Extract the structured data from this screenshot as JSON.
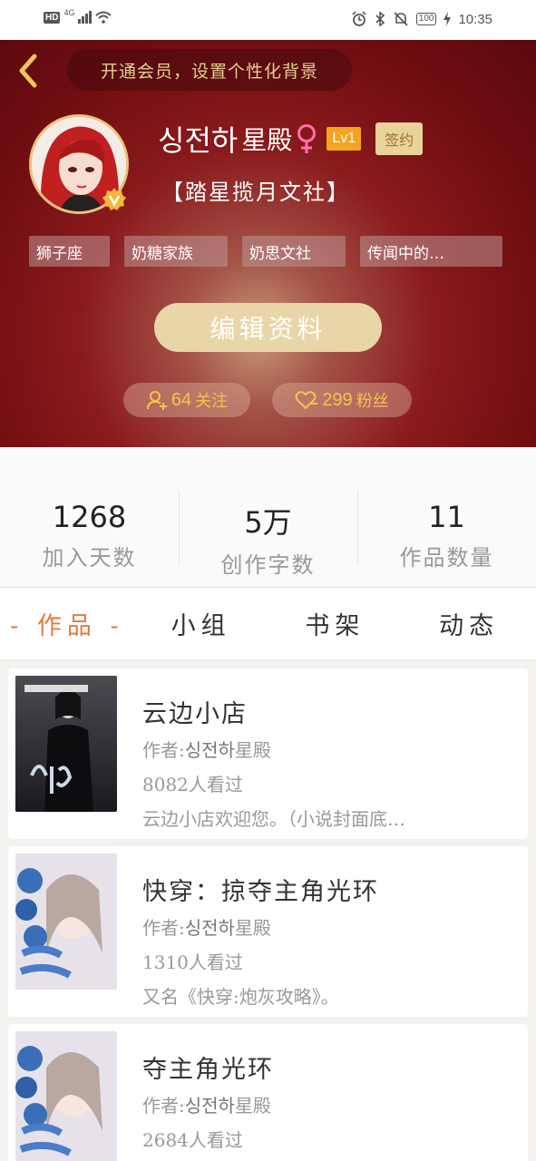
{
  "status_bar": {
    "network_hd": "HD",
    "network_type": "4G",
    "battery": "100",
    "time": "10:35"
  },
  "header": {
    "vip_banner": "开通会员，设置个性化背景",
    "name_main": "싱전하",
    "name_suffix": "星殿",
    "level": "Lv1",
    "sign_badge": "签约",
    "organization": "【踏星揽月文社】",
    "tags": [
      "狮子座",
      "奶糖家族",
      "奶思文社",
      "传闻中的…"
    ],
    "edit_button": "编辑资料",
    "following_count": "64",
    "following_label": "关注",
    "fans_count": "299",
    "fans_label": "粉丝"
  },
  "stats": [
    {
      "value": "1268",
      "label": "加入天数"
    },
    {
      "value": "5万",
      "label": "创作字数"
    },
    {
      "value": "11",
      "label": "作品数量"
    }
  ],
  "tabs": [
    "- 作品 -",
    "小组",
    "书架",
    "动态"
  ],
  "works": [
    {
      "title": "云边小店",
      "author_prefix": "作者:",
      "author_name": "싱전하",
      "author_suffix": "星殿",
      "views": "8082人看过",
      "desc": "云边小店欢迎您。（小说封面底…"
    },
    {
      "title": "快穿：掠夺主角光环",
      "author_prefix": "作者:",
      "author_name": "싱전하",
      "author_suffix": "星殿",
      "views": "1310人看过",
      "desc": "又名《快穿:炮灰攻略》。"
    },
    {
      "title": "夺主角光环",
      "author_prefix": "作者:",
      "author_name": "싱전하",
      "author_suffix": "星殿",
      "views": "2684人看过",
      "desc": ""
    }
  ],
  "colors": {
    "accent": "#e27a3f",
    "header_red": "#8a1a1c",
    "gold": "#f1c64b",
    "level_badge": "#f3a521"
  }
}
